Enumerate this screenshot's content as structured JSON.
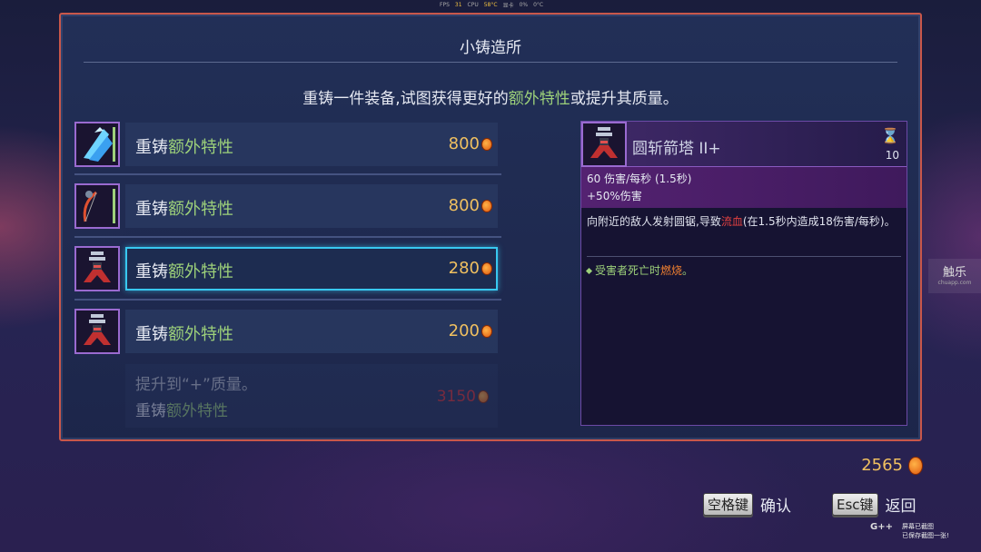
{
  "hud": {
    "fps_label": "FPS",
    "fps": "31",
    "cpu_label": "CPU",
    "cpu_temp": "58°C",
    "gpu_label": "显卡",
    "gpu_usage": "0%",
    "gpu_temp": "0°C"
  },
  "panel": {
    "title": "小铸造所",
    "subtitle_a": "重铸一件装备,试图获得更好的",
    "subtitle_highlight": "额外特性",
    "subtitle_b": "或提升其质量。"
  },
  "items": [
    {
      "label_a": "重铸",
      "label_b": "额外特性",
      "price": "800",
      "icon": "ice-shard-icon"
    },
    {
      "label_a": "重铸",
      "label_b": "额外特性",
      "price": "800",
      "icon": "bow-icon"
    },
    {
      "label_a": "重铸",
      "label_b": "额外特性",
      "price": "280",
      "icon": "turret-icon",
      "selected": true
    },
    {
      "label_a": "重铸",
      "label_b": "额外特性",
      "price": "200",
      "icon": "turret-icon"
    }
  ],
  "upgrade": {
    "line1": "提升到“+”质量。",
    "line2_a": "重铸",
    "line2_b": "额外特性",
    "price": "3150"
  },
  "detail": {
    "name": "圆斩箭塔 II+",
    "timer": "10",
    "stat1": "60 伤害/每秒 (1.5秒)",
    "stat2": "+50%伤害",
    "desc_a": "向附近的敌人发射圆锯,导致",
    "desc_red": "流血",
    "desc_b": "(在1.5秒内造成18伤害/每秒)。",
    "effect_a": "受害者死亡时",
    "effect_orange": "燃烧",
    "effect_b": "。"
  },
  "currency": {
    "amount": "2565"
  },
  "controls": {
    "confirm_key": "空格键",
    "confirm_label": "确认",
    "back_key": "Esc键",
    "back_label": "返回"
  },
  "overlay": {
    "watermark": "触乐",
    "watermark_sub": "chuapp.com",
    "screenshot_line1": "屏幕已截图",
    "screenshot_line2": "已保存截图一张!",
    "logo": "G++"
  },
  "colors": {
    "accent_green": "#9dd17a",
    "gold": "#f0c060",
    "selection": "#38c8f0",
    "border_red": "#c9574a"
  }
}
